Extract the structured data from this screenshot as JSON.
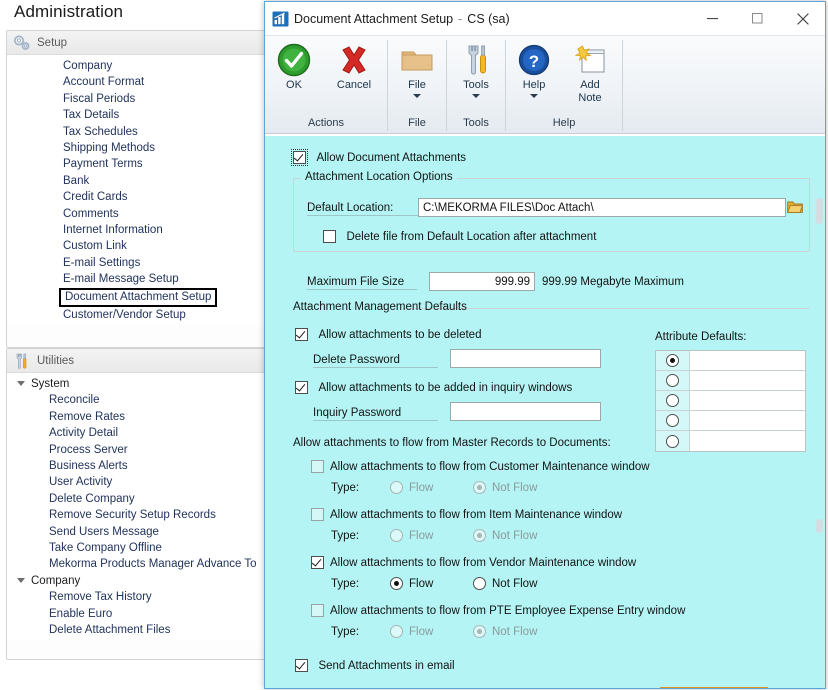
{
  "nav": {
    "page_title": "Administration",
    "setup": {
      "header_label": "Setup",
      "header_icon": "gears-icon",
      "items": [
        "Company",
        "Account Format",
        "Fiscal Periods",
        "Tax Details",
        "Tax Schedules",
        "Shipping Methods",
        "Payment Terms",
        "Bank",
        "Credit Cards",
        "Comments",
        "Internet Information",
        "Custom Link",
        "E-mail Settings",
        "E-mail Message Setup",
        "Document Attachment Setup",
        "Customer/Vendor Setup"
      ],
      "selected": "Document Attachment Setup"
    },
    "utilities": {
      "header_label": "Utilities",
      "header_icon": "tools-icon",
      "groups": [
        {
          "label": "System",
          "items": [
            "Reconcile",
            "Remove Rates",
            "Activity Detail",
            "Process Server",
            "Business Alerts",
            "User Activity",
            "Delete Company",
            "Remove Security Setup Records",
            "Send Users Message",
            "Take Company Offline",
            "Mekorma Products Manager Advance To"
          ]
        },
        {
          "label": "Company",
          "items": [
            "Remove Tax History",
            "Enable Euro",
            "Delete Attachment Files"
          ]
        }
      ]
    }
  },
  "dialog": {
    "title": "Document Attachment Setup",
    "title_separator": "-",
    "title_context": "CS (sa)",
    "title_icon": "chart-window-icon",
    "window_controls": {
      "minimize": "minimize-icon",
      "maximize": "maximize-icon",
      "close": "close-icon"
    },
    "ribbon": {
      "groups": [
        {
          "label": "Actions",
          "buttons": [
            {
              "label": "OK",
              "icon": "green-check-icon",
              "caret": false
            },
            {
              "label": "Cancel",
              "icon": "red-x-icon",
              "caret": false
            }
          ]
        },
        {
          "label": "File",
          "buttons": [
            {
              "label": "File",
              "icon": "folder-icon",
              "caret": true
            }
          ]
        },
        {
          "label": "Tools",
          "buttons": [
            {
              "label": "Tools",
              "icon": "wrench-screwdriver-icon",
              "caret": true
            }
          ]
        },
        {
          "label": "Help",
          "buttons": [
            {
              "label": "Help",
              "icon": "blue-question-icon",
              "caret": true
            },
            {
              "label": "Add\nNote",
              "label_line1": "Add",
              "label_line2": "Note",
              "icon": "add-note-icon",
              "caret": false
            }
          ]
        }
      ]
    },
    "form": {
      "allow_document_attachments": {
        "label": "Allow Document Attachments",
        "checked": true
      },
      "location_group": {
        "legend": "Attachment Location Options",
        "default_location_label": "Default Location:",
        "default_location_value": "C:\\MEKORMA FILES\\Doc Attach\\",
        "browse_icon": "folder-open-icon",
        "delete_after_attachment": {
          "label": "Delete file from Default Location after attachment",
          "checked": false
        }
      },
      "max_file_size": {
        "label": "Maximum File Size",
        "value": "999.99",
        "suffix": "999.99 Megabyte Maximum"
      },
      "management_group": {
        "legend": "Attachment Management Defaults",
        "allow_delete": {
          "label": "Allow attachments to be deleted",
          "checked": true
        },
        "delete_password": {
          "label": "Delete Password",
          "value": ""
        },
        "allow_inquiry_add": {
          "label": "Allow attachments to be added in inquiry windows",
          "checked": true
        },
        "inquiry_password": {
          "label": "Inquiry Password",
          "value": ""
        },
        "flow_heading": "Allow attachments to flow from Master Records to Documents:",
        "type_label": "Type:",
        "flow_option_labels": {
          "flow": "Flow",
          "not_flow": "Not Flow"
        },
        "flow_rows": [
          {
            "label": "Allow attachments to flow from Customer Maintenance window",
            "checked": false,
            "enabled": false,
            "selected_type": "Not Flow"
          },
          {
            "label": "Allow attachments to flow from Item Maintenance window",
            "checked": false,
            "enabled": false,
            "selected_type": "Not Flow"
          },
          {
            "label": "Allow attachments to flow from Vendor Maintenance window",
            "checked": true,
            "enabled": true,
            "selected_type": "Flow"
          },
          {
            "label": "Allow attachments to flow from PTE Employee Expense Entry window",
            "checked": false,
            "enabled": false,
            "selected_type": "Not Flow"
          }
        ]
      },
      "attribute_defaults": {
        "label": "Attribute Defaults:",
        "rows": [
          {
            "selected": true,
            "value": ""
          },
          {
            "selected": false,
            "value": ""
          },
          {
            "selected": false,
            "value": ""
          },
          {
            "selected": false,
            "value": ""
          },
          {
            "selected": false,
            "value": ""
          }
        ]
      },
      "send_attachments_in_email": {
        "label": "Send Attachments in email",
        "checked": true
      }
    }
  },
  "colors": {
    "form_background": "#b4f4f4",
    "dialog_border": "#5ba6d8",
    "nav_link": "#22335c",
    "accent_orange": "#e8921b"
  }
}
